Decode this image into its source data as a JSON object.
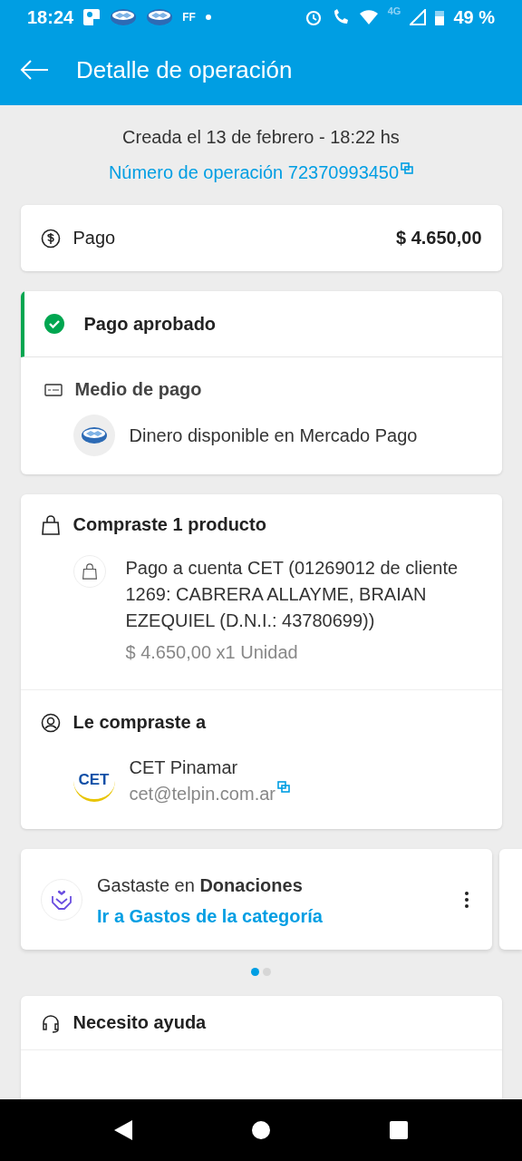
{
  "status_bar": {
    "time": "18:24",
    "notif_label": "FF",
    "network": "4G",
    "battery": "49 %"
  },
  "app_bar": {
    "title": "Detalle de operación"
  },
  "header": {
    "created": "Creada el 13 de febrero - 18:22 hs",
    "operation": "Número de operación 72370993450"
  },
  "payment": {
    "label": "Pago",
    "amount": "$ 4.650,00"
  },
  "status": {
    "label": "Pago aprobado",
    "kind": "approved"
  },
  "method": {
    "title": "Medio de pago",
    "value": "Dinero disponible en Mercado Pago"
  },
  "purchase": {
    "title": "Compraste 1 producto",
    "product": "Pago a cuenta CET (01269012 de cliente 1269: CABRERA ALLAYME, BRAIAN EZEQUIEL (D.N.I.: 43780699))",
    "price": "$ 4.650,00 x1 Unidad"
  },
  "seller": {
    "title": "Le compraste a",
    "logo_text": "CET",
    "name": "CET Pinamar",
    "email": "cet@telpin.com.ar"
  },
  "category": {
    "text": "Gastaste en **Donaciones**",
    "link": "Ir a Gastos de la categoría"
  },
  "carousel_dots": [
    {
      "selected": true
    },
    {
      "selected": false
    }
  ],
  "help": {
    "title": "Necesito ayuda"
  }
}
